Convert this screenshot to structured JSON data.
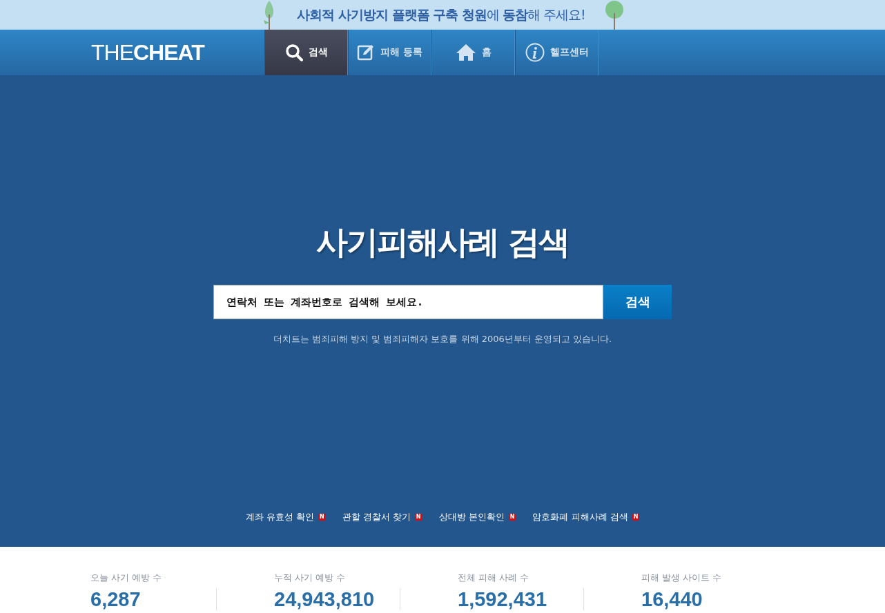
{
  "banner": {
    "text": "**사회적 사기방지 플랫폼 구축 청원**에 **동참**해 주세요!"
  },
  "header": {
    "logo": "THE**CHEAT**",
    "tabs": [
      {
        "label": "검색",
        "kind": "search",
        "selected": true
      },
      {
        "label": "피해 등록",
        "kind": "edit",
        "selected": false
      },
      {
        "label": "홈",
        "kind": "home",
        "selected": false
      },
      {
        "label": "헬프센터",
        "kind": "info",
        "selected": false
      }
    ]
  },
  "hero": {
    "title": "사기피해사례 검색",
    "search": {
      "placeholder": "연락처 또는 계좌번호로 검색해 보세요.",
      "button": "검색"
    },
    "note": "더치트는 범죄피해 방지 및 범죄피해자 보호를 위해 2006년부터 운영되고 있습니다.",
    "links": [
      {
        "label": "계좌 유효성 확인",
        "badge": "N"
      },
      {
        "label": "관할 경찰서 찾기",
        "badge": "N"
      },
      {
        "label": "상대방 본인확인",
        "badge": "N"
      },
      {
        "label": "암호화폐 피해사례 검색",
        "badge": "N"
      }
    ]
  },
  "stats": [
    {
      "label": "오늘 사기 예방 수",
      "value": "6,287"
    },
    {
      "label": "누적 사기 예방 수",
      "value": "24,943,810"
    },
    {
      "label": "전체 피해 사례 수",
      "value": "1,592,431"
    },
    {
      "label": "피해 발생 사이트 수",
      "value": "16,440"
    }
  ]
}
